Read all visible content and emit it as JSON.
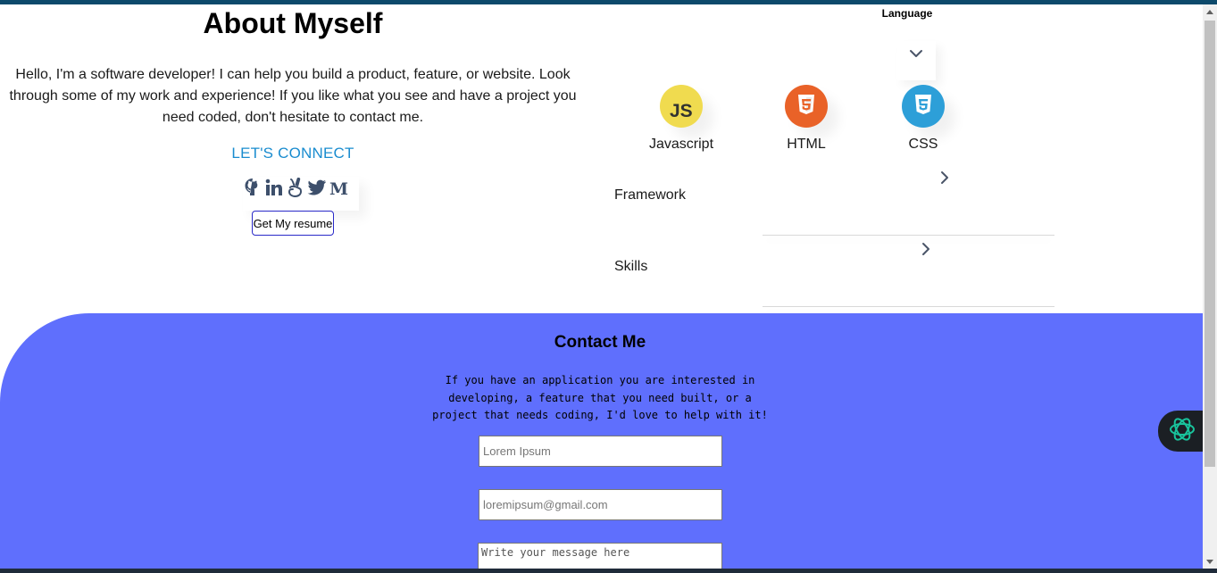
{
  "about": {
    "title": "About Myself",
    "description": "Hello, I'm a software developer! I can help you build a product, feature, or website. Look through some of my work and experience! If you like what you see and have a project you need coded, don't hesitate to contact me.",
    "connect_label": "LET'S CONNECT",
    "social_icons": [
      "github-icon",
      "linkedin-icon",
      "angellist-icon",
      "twitter-icon",
      "medium-icon"
    ],
    "resume_button": "Get My resume"
  },
  "skills_panel": {
    "language_title": "Language",
    "languages": [
      {
        "label": "Javascript",
        "icon": "javascript-icon",
        "color": "#f0db4f"
      },
      {
        "label": "HTML",
        "icon": "html5-icon",
        "color": "#e96228"
      },
      {
        "label": "CSS",
        "icon": "css3-icon",
        "color": "#2d9fd8"
      }
    ],
    "rows": [
      {
        "label": "Framework"
      },
      {
        "label": "Skills"
      }
    ]
  },
  "contact": {
    "title": "Contact Me",
    "description": "If you have an application you are interested in developing, a feature that you need built, or a project that needs coding, I'd love to help with it!",
    "name_placeholder": "Lorem Ipsum",
    "email_placeholder": "loremipsum@gmail.com",
    "message_placeholder": "Write your message here",
    "background_color": "#5f6ffd"
  },
  "colors": {
    "accent_link": "#1a8ccf",
    "button_border": "#2929c8",
    "top_bar": "#0d4a6b"
  }
}
